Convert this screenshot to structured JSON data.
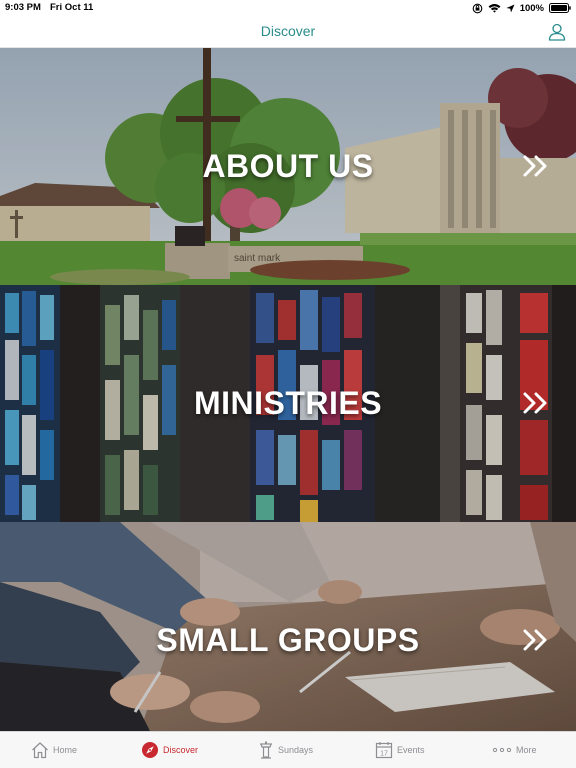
{
  "status_bar": {
    "time": "9:03 PM",
    "date": "Fri Oct 11",
    "battery": "100%"
  },
  "nav": {
    "title": "Discover"
  },
  "tiles": [
    {
      "label": "ABOUT US"
    },
    {
      "label": "MINISTRIES"
    },
    {
      "label": "SMALL GROUPS"
    }
  ],
  "sign_text": "saint mark",
  "tabs": [
    {
      "label": "Home",
      "icon": "home-icon"
    },
    {
      "label": "Discover",
      "icon": "compass-icon"
    },
    {
      "label": "Sundays",
      "icon": "podium-icon"
    },
    {
      "label": "Events",
      "icon": "calendar-icon",
      "calendar_day": "17"
    },
    {
      "label": "More",
      "icon": "more-dots-icon"
    }
  ],
  "colors": {
    "accent": "#2a8c8c",
    "active_tab": "#c8282f",
    "inactive_tab": "#8e8e93"
  }
}
